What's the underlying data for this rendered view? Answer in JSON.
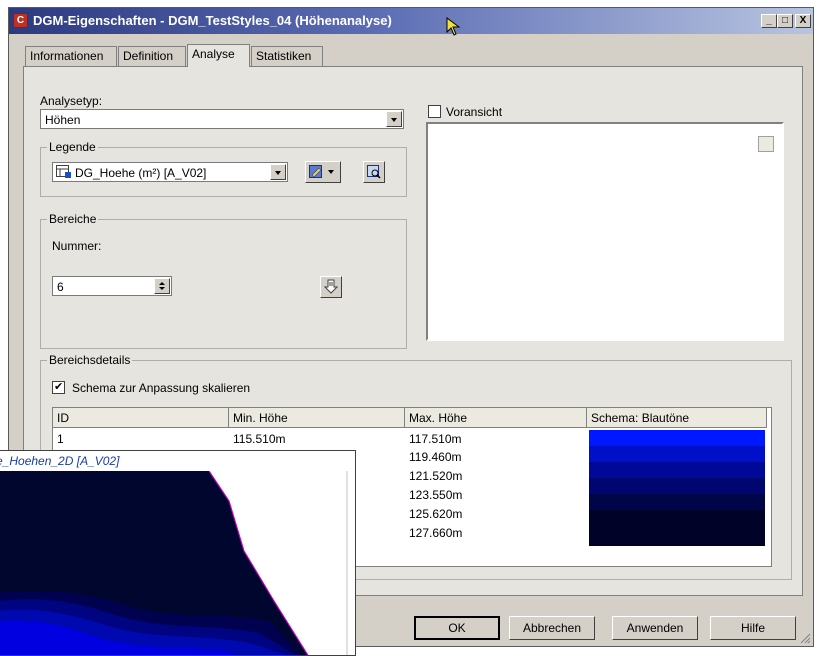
{
  "window": {
    "title": "DGM-Eigenschaften - DGM_TestStyles_04 (Höhenanalyse)",
    "controls": [
      "_",
      "□",
      "X"
    ]
  },
  "tabs": [
    {
      "label": "Informationen",
      "active": false
    },
    {
      "label": "Definition",
      "active": false
    },
    {
      "label": "Analyse",
      "active": true
    },
    {
      "label": "Statistiken",
      "active": false
    }
  ],
  "analyse": {
    "analysetyp_label": "Analysetyp:",
    "analysetyp_value": "Höhen",
    "legende_title": "Legende",
    "legende_value": "DG_Hoehe (m²) [A_V02]",
    "voransicht_label": "Voransicht",
    "voransicht_checked": false,
    "bereiche_title": "Bereiche",
    "nummer_label": "Nummer:",
    "nummer_value": "6",
    "bereichsdetails_title": "Bereichsdetails",
    "schema_label": "Schema zur Anpassung skalieren",
    "schema_checked": true
  },
  "table": {
    "columns": [
      "ID",
      "Min. Höhe",
      "Max. Höhe",
      "Schema: Blautöne"
    ],
    "rows": [
      {
        "id": "1",
        "min": "115.510m",
        "max": "117.510m",
        "color": "#0018ff"
      },
      {
        "id": "",
        "min": "",
        "max": "119.460m",
        "color": "#0010c8"
      },
      {
        "id": "",
        "min": "",
        "max": "121.520m",
        "color": "#000898"
      },
      {
        "id": "",
        "min": "",
        "max": "123.550m",
        "color": "#000670"
      },
      {
        "id": "",
        "min": "",
        "max": "125.620m",
        "color": "#000448"
      },
      {
        "id": "",
        "min": "",
        "max": "127.660m",
        "color": "#000228"
      }
    ]
  },
  "buttons": {
    "ok": "OK",
    "cancel": "Abbrechen",
    "apply": "Anwenden",
    "help": "Hilfe"
  },
  "overlay": {
    "title": "e_Hoehen_2D [A_V02]",
    "colors": [
      "#0000e0",
      "#0008b0",
      "#000480",
      "#000250",
      "#00062e"
    ]
  }
}
